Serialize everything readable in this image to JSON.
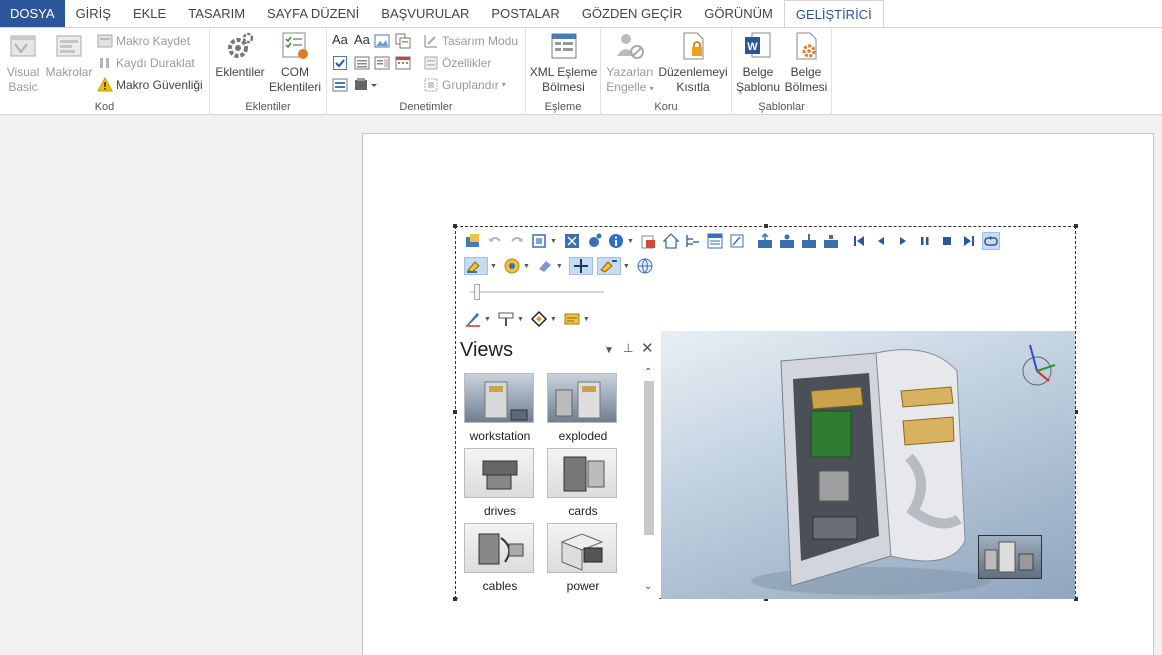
{
  "tabs": [
    "DOSYA",
    "GİRİŞ",
    "EKLE",
    "TASARIM",
    "SAYFA DÜZENİ",
    "BAŞVURULAR",
    "POSTALAR",
    "GÖZDEN GEÇİR",
    "GÖRÜNÜM",
    "GELİŞTİRİCİ"
  ],
  "ribbon": {
    "kod": {
      "label": "Kod",
      "visual_basic": "Visual Basic",
      "makrolar": "Makrolar",
      "makro_kaydet": "Makro Kaydet",
      "kaydi_duraklat": "Kaydı Duraklat",
      "makro_guvenligi": "Makro Güvenliği"
    },
    "eklentiler": {
      "label": "Eklentiler",
      "eklentiler": "Eklentiler",
      "com": "COM Eklentileri"
    },
    "denetimler": {
      "label": "Denetimler",
      "tasarim_modu": "Tasarım Modu",
      "ozellikler": "Özellikler",
      "gruplandir": "Gruplandır"
    },
    "esleme": {
      "label": "Eşleme",
      "xml": "XML Eşleme Bölmesi"
    },
    "koru": {
      "label": "Koru",
      "yazarlari": "Yazarları Engelle",
      "duzenlemeyi": "Düzenlemeyi Kısıtla"
    },
    "sablonlar": {
      "label": "Şablonlar",
      "belge_sablonu": "Belge Şablonu",
      "belge_bolmesi": "Belge Bölmesi"
    }
  },
  "views": {
    "title": "Views",
    "items": [
      {
        "label": "workstation"
      },
      {
        "label": "exploded"
      },
      {
        "label": "drives"
      },
      {
        "label": "cards"
      },
      {
        "label": "cables"
      },
      {
        "label": "power"
      }
    ]
  },
  "colors": {
    "brand": "#2b579a",
    "viewport_top": "#e8eff5",
    "viewport_bottom": "#8fa6bd"
  }
}
